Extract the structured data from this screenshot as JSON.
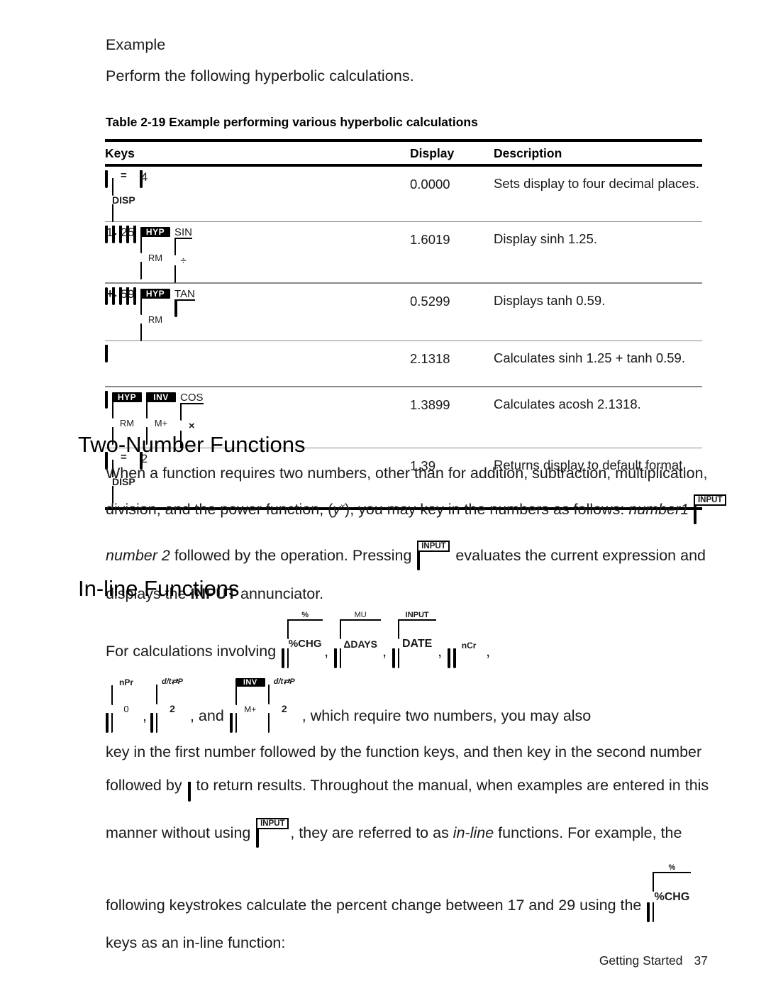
{
  "intro": {
    "heading": "Example",
    "sentence": "Perform the following hyperbolic calculations."
  },
  "table": {
    "caption": "Table 2-19  Example performing various hyperbolic calculations",
    "columns": [
      "Keys",
      "Display",
      "Description"
    ],
    "rows": [
      {
        "keys_desc": "shift-down, DISP, 4",
        "display": "0.0000",
        "description": "Sets display to four decimal places."
      },
      {
        "keys_desc": "1, ., 2, 5, shift-up, HYP/RM, SIN/divide",
        "display": "1.6019",
        "description": "Display sinh 1.25."
      },
      {
        "keys_desc": "plus, ., 5, 9, shift-up, HYP/RM, TAN/minus",
        "display": "0.5299",
        "description": "Displays tanh 0.59."
      },
      {
        "keys_desc": "equals",
        "display": "2.1318",
        "description": "Calculates sinh 1.25 + tanh 0.59."
      },
      {
        "keys_desc": "shift-up, HYP/RM, INV/M+, COS/multiply",
        "display": "1.3899",
        "description": "Calculates acosh 2.1318."
      },
      {
        "keys_desc": "shift-down, DISP, 2",
        "display": "1.39",
        "description": "Returns display to default format."
      }
    ]
  },
  "keycaps": {
    "disp_top": "=",
    "disp_bottom": "DISP",
    "four": "4",
    "two": "2",
    "one": "1",
    "five": "5",
    "nine": "9",
    "dot": ".",
    "plus": "+",
    "equals": "=",
    "hyp": "HYP",
    "rm": "RM",
    "inv": "INV",
    "mplus": "M+",
    "sin": "SIN",
    "tan": "TAN",
    "cos": "COS",
    "divide": "÷",
    "minus": "−",
    "multiply": "×",
    "input": "INPUT",
    "percent": "%",
    "pctchg": "%CHG",
    "mu": "MU",
    "ddays": "ΔDAYS",
    "date": "DATE",
    "ncr": "nCr",
    "ncr_body": "•",
    "npr": "nPr",
    "zero": "0",
    "dft_p": "d/t⇄P"
  },
  "section_two_number": {
    "heading": "Two-Number Functions",
    "line1": "When a function requires two numbers, other than for addition, subtraction, multiplication,",
    "line2_a": "division, and the power function, (",
    "line2_y": "y",
    "line2_x": "x",
    "line2_b": "), you may key in the numbers as follows: ",
    "line2_italic": "number1",
    "line3_italic": "number 2",
    "line3_a": " followed by the operation. Pressing ",
    "line3_b": " evaluates the current expression and",
    "line4_a": "displays the ",
    "line4_bold": "INPUT",
    "line4_b": " annunciator."
  },
  "section_inline": {
    "heading": "In-line Functions",
    "line1_a": "For calculations involving ",
    "line2_and": ", and ",
    "line2_tail": ", which require two numbers, you may also",
    "line3": "key in the first number followed by the function keys, and then key in the second number",
    "line4_a": "followed by ",
    "line4_b": " to return results. Throughout the manual, when examples are entered in this",
    "line5_a": "manner without using ",
    "line5_b": ", they are referred to as ",
    "line5_italic": "in-line",
    "line5_c": " functions. For example, the",
    "line6_a": "following keystrokes calculate the percent change between 17 and 29 using the ",
    "line7": "keys as an in-line function:",
    "comma": ","
  },
  "footer": {
    "section": "Getting Started",
    "page": "37"
  },
  "colors": {
    "text": "#1a1a1a",
    "rule_thick": "#000000",
    "rule_thin": "#8a8a8a",
    "key_fill": "#ffffff",
    "key_stroke": "#000000"
  }
}
